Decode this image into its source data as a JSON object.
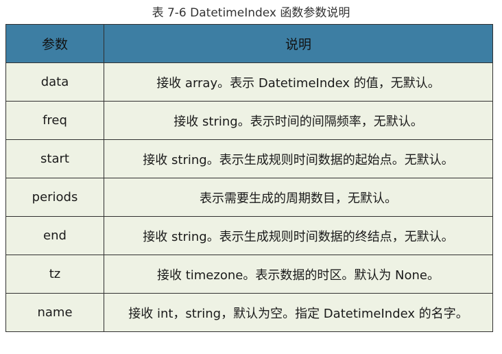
{
  "caption": "表 7-6 DatetimeIndex 函数参数说明",
  "table": {
    "headers": [
      "参数",
      "说明"
    ],
    "rows": [
      {
        "param": "data",
        "desc": "接收 array。表示 DatetimeIndex 的值，无默认。"
      },
      {
        "param": "freq",
        "desc": "接收 string。表示时间的间隔频率，无默认。"
      },
      {
        "param": "start",
        "desc": "接收 string。表示生成规则时间数据的起始点。无默认。"
      },
      {
        "param": "periods",
        "desc": "表示需要生成的周期数目，无默认。"
      },
      {
        "param": "end",
        "desc": "接收 string。表示生成规则时间数据的终结点，无默认。"
      },
      {
        "param": "tz",
        "desc": "接收 timezone。表示数据的时区。默认为 None。"
      },
      {
        "param": "name",
        "desc": "接收 int，string，默认为空。指定 DatetimeIndex 的名字。"
      }
    ]
  }
}
